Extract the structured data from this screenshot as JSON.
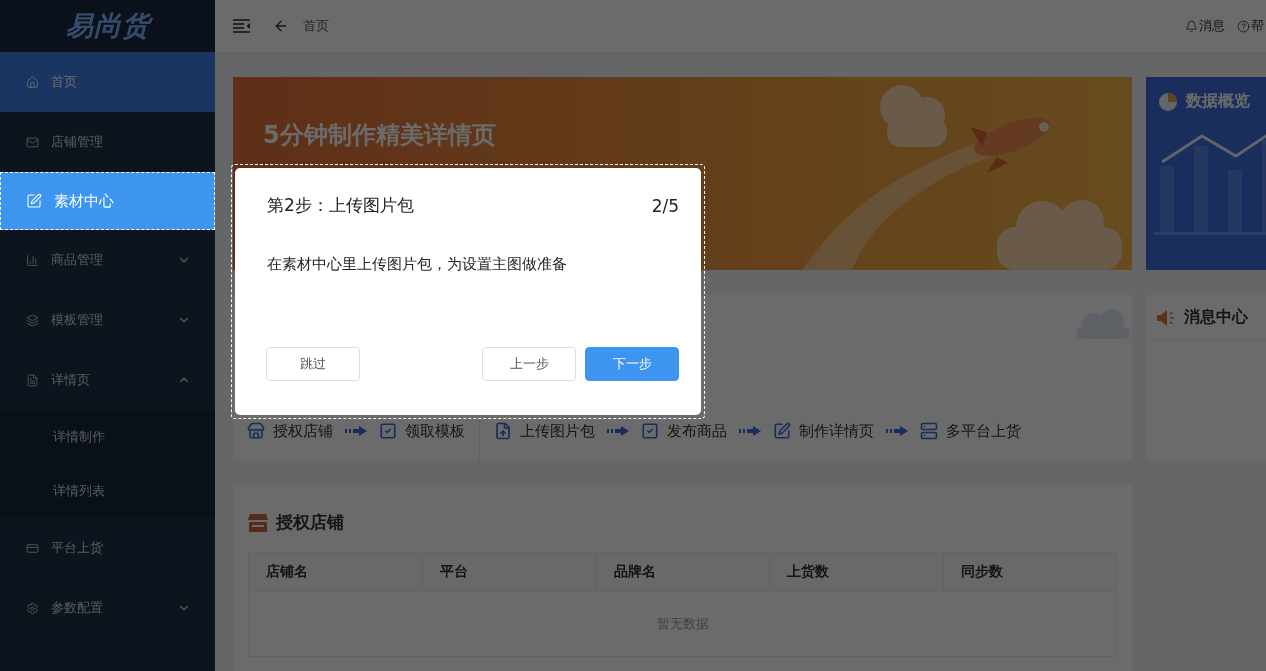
{
  "logo": "易尚货",
  "sidebar": {
    "items": [
      {
        "label": "首页",
        "selected": true,
        "spotlight": false
      },
      {
        "label": "店铺管理",
        "selected": false,
        "spotlight": false
      },
      {
        "label": "素材中心",
        "selected": false,
        "spotlight": true
      },
      {
        "label": "商品管理",
        "selected": false,
        "spotlight": false,
        "expanded": false
      },
      {
        "label": "模板管理",
        "selected": false,
        "spotlight": false,
        "expanded": false
      },
      {
        "label": "详情页",
        "selected": false,
        "spotlight": false,
        "expanded": true,
        "children": [
          {
            "label": "详情制作",
            "selected": false
          },
          {
            "label": "详情列表",
            "selected": false
          }
        ]
      },
      {
        "label": "平台上货",
        "selected": false,
        "spotlight": false
      },
      {
        "label": "参数配置",
        "selected": false,
        "spotlight": false,
        "expanded": false
      }
    ]
  },
  "header": {
    "breadcrumb": "首页",
    "actions": [
      {
        "label": "消息"
      },
      {
        "label": "帮"
      }
    ]
  },
  "banner": {
    "title": "5分钟制作精美详情页"
  },
  "overview": {
    "title": "数据概览"
  },
  "steps": {
    "groups": [
      [
        {
          "label": "授权店铺"
        },
        {
          "label": "领取模板"
        }
      ],
      [
        {
          "label": "上传图片包"
        },
        {
          "label": "发布商品"
        },
        {
          "label": "制作详情页"
        },
        {
          "label": "多平台上货"
        }
      ]
    ]
  },
  "messages": {
    "title": "消息中心"
  },
  "shops": {
    "title": "授权店铺",
    "table": {
      "columns": [
        "店铺名",
        "平台",
        "品牌名",
        "上货数",
        "同步数"
      ],
      "empty": "暂无数据"
    }
  },
  "tour": {
    "title": "第2步：上传图片包",
    "counter": "2/5",
    "body": "在素材中心里上传图片包，为设置主图做准备",
    "buttons": [
      {
        "label": "跳过",
        "primary": false
      },
      {
        "label": "上一步",
        "primary": false
      },
      {
        "label": "下一步",
        "primary": true
      }
    ]
  }
}
